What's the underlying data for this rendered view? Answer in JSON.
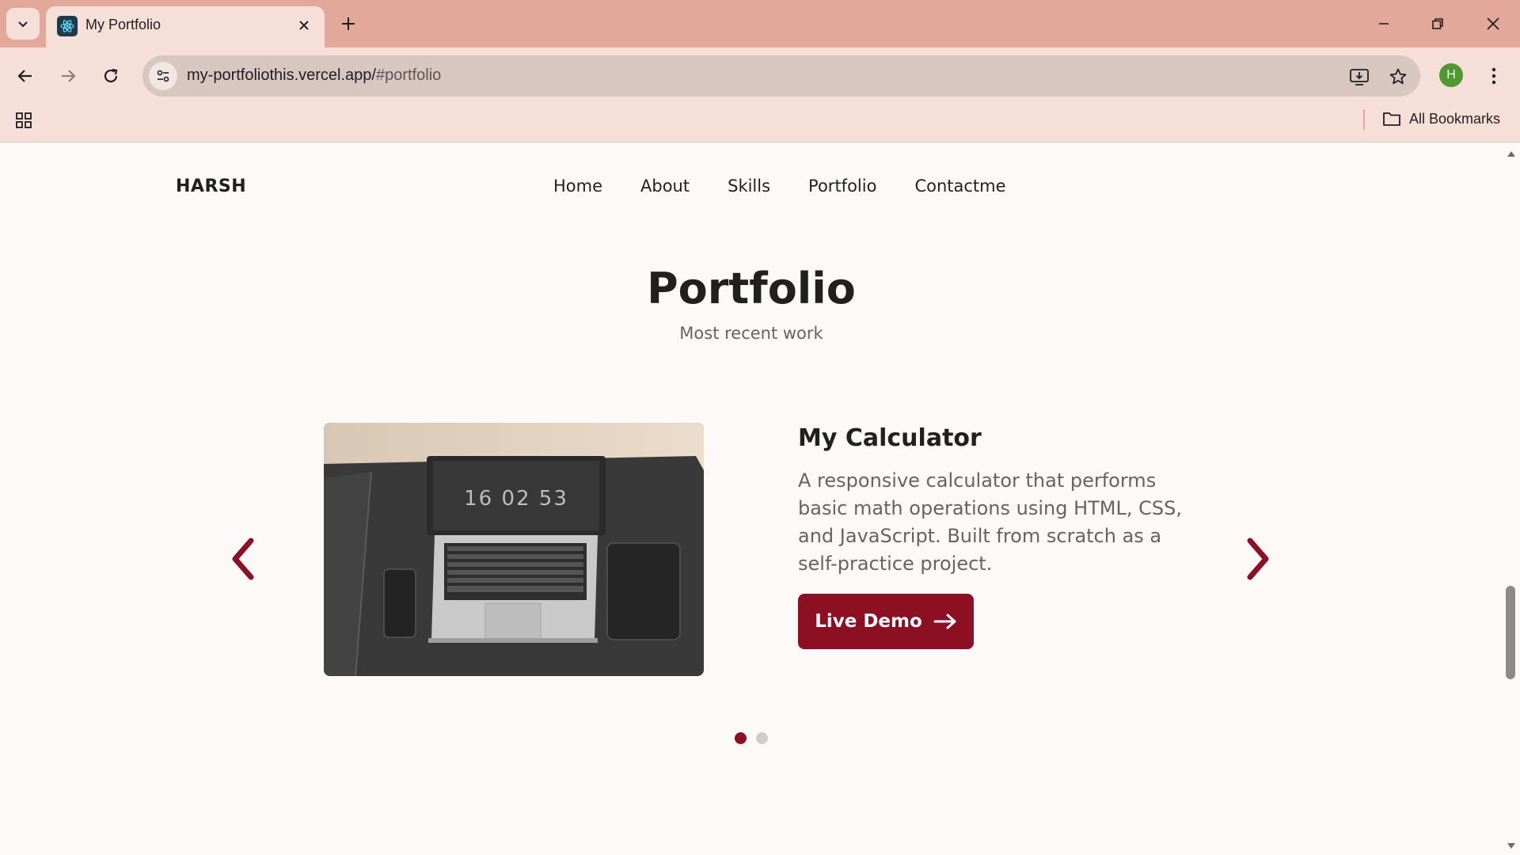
{
  "browser": {
    "tab_title": "My Portfolio",
    "url_host": "my-portfoliothis.vercel.app/",
    "url_path": "#portfolio",
    "profile_initial": "H",
    "all_bookmarks_label": "All Bookmarks",
    "accent_color": "#e2a899"
  },
  "site": {
    "logo": "HARSH",
    "nav": [
      "Home",
      "About",
      "Skills",
      "Portfolio",
      "Contactme"
    ]
  },
  "portfolio": {
    "title": "Portfolio",
    "subtitle": "Most recent work",
    "project": {
      "title": "My Calculator",
      "description": "A responsive calculator that performs basic math operations using HTML, CSS, and JavaScript. Built from scratch as a self-practice project.",
      "button_label": "Live Demo",
      "laptop_screen_text": "16 02 53"
    },
    "slides_total": 2,
    "active_slide": 1,
    "accent_color": "#8c0f22"
  }
}
